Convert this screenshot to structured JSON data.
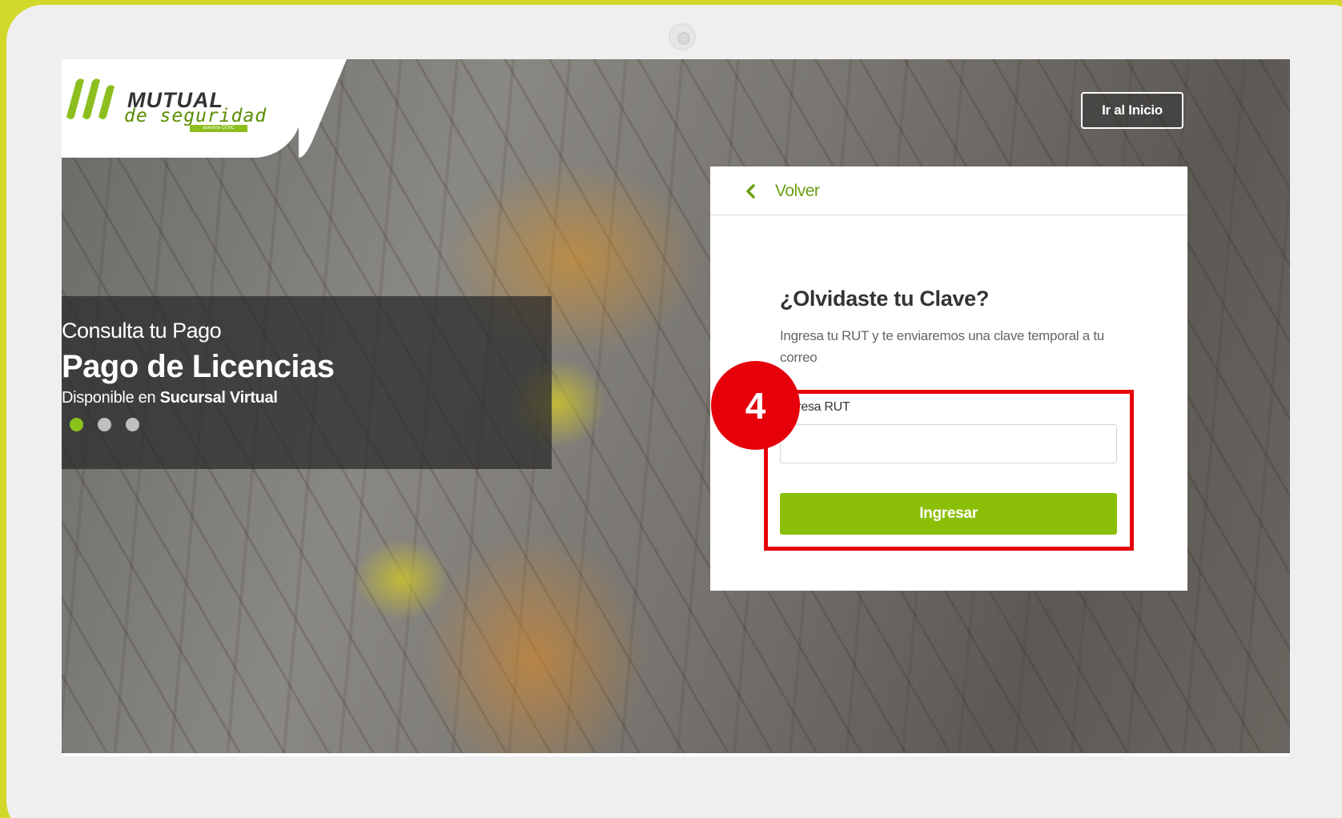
{
  "brand": {
    "name": "MUTUAL",
    "subtitle": "de seguridad",
    "tag": "asesora CChC",
    "accent_color": "#8cbf08",
    "frame_color": "#d2d82a",
    "highlight_color": "#e5000a"
  },
  "header": {
    "home_button_label": "Ir al Inicio"
  },
  "banner": {
    "kicker": "Consulta tu Pago",
    "headline": "Pago de Licencias",
    "line_prefix": "Disponible en ",
    "line_bold": "Sucursal Virtual",
    "slides": 3,
    "active_slide": 1
  },
  "card": {
    "back_label": "Volver",
    "back_icon": "chevron-left-icon",
    "title": "¿Olvidaste tu Clave?",
    "description": "Ingresa tu RUT y te enviaremos una clave temporal a tu correo",
    "field_label": "Ingresa RUT",
    "field_value": "",
    "submit_label": "Ingresar"
  },
  "annotation": {
    "step_number": "4"
  }
}
